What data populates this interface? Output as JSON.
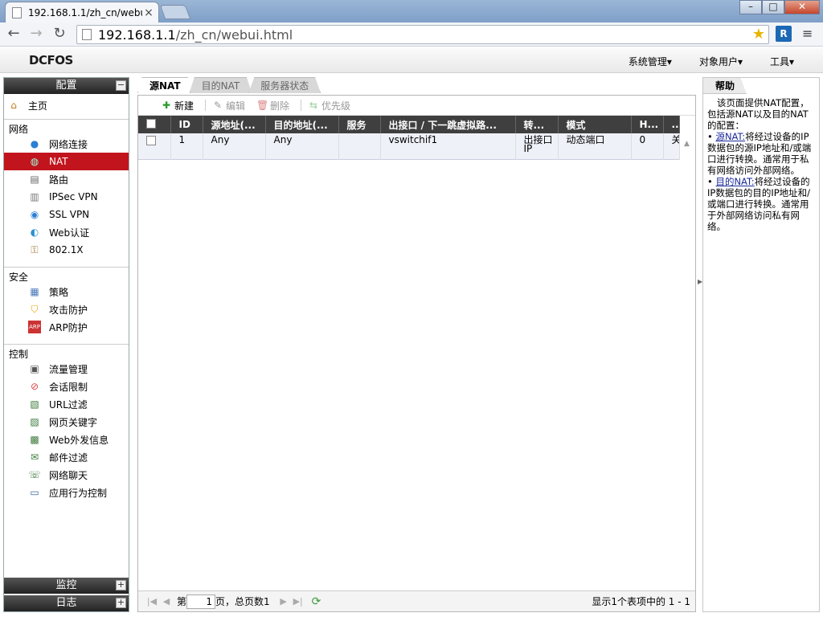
{
  "browser": {
    "tab_title": "192.168.1.1/zh_cn/webu",
    "tab_close": "×",
    "url_host": "192.168.1.1",
    "url_path": "/zh_cn/webui.html",
    "win_min": "–",
    "win_max": "□",
    "win_close": "✕"
  },
  "app": {
    "logo": "DCFOS",
    "menu": [
      "系统管理▾",
      "对象用户▾",
      "工具▾"
    ]
  },
  "sidebar": {
    "config_title": "配置",
    "config_toggle": "−",
    "home": "主页",
    "sections": {
      "network": "网络",
      "security": "安全",
      "control": "控制"
    },
    "network_items": [
      "网络连接",
      "NAT",
      "路由",
      "IPSec VPN",
      "SSL VPN",
      "Web认证",
      "802.1X"
    ],
    "security_items": [
      "策略",
      "攻击防护",
      "ARP防护"
    ],
    "control_items": [
      "流量管理",
      "会话限制",
      "URL过滤",
      "网页关键字",
      "Web外发信息",
      "邮件过滤",
      "网络聊天",
      "应用行为控制"
    ],
    "monitor_title": "监控",
    "log_title": "日志",
    "plus": "+"
  },
  "main": {
    "tabs": [
      "源NAT",
      "目的NAT",
      "服务器状态"
    ],
    "toolbar": {
      "new": "新建",
      "edit": "编辑",
      "delete": "删除",
      "priority": "优先级"
    },
    "columns": [
      "ID",
      "源地址(...",
      "目的地址(...",
      "服务",
      "出接口 / 下一跳虚拟路...",
      "转...",
      "模式",
      "H...",
      "..."
    ],
    "rows": [
      {
        "id": "1",
        "src": "Any",
        "dst": "Any",
        "service": "",
        "egress": "vswitchif1",
        "trans1": "出接口",
        "trans2": "IP",
        "mode": "动态端口",
        "h": "0",
        "more": "关"
      }
    ],
    "pager": {
      "page_prefix": "第",
      "page_value": "1",
      "page_suffix": "页，总页数1",
      "info": "显示1个表项中的 1 - 1"
    }
  },
  "help": {
    "title": "帮助",
    "intro": "该页面提供NAT配置，包括源NAT以及目的NAT的配置：",
    "src_link": "源NAT:",
    "src_text": "将经过设备的IP数据包的源IP地址和/或端口进行转换。通常用于私有网络访问外部网络。",
    "dst_link": "目的NAT:",
    "dst_text": "将经过设备的IP数据包的目的IP地址和/或端口进行转换。通常用于外部网络访问私有网络。"
  }
}
